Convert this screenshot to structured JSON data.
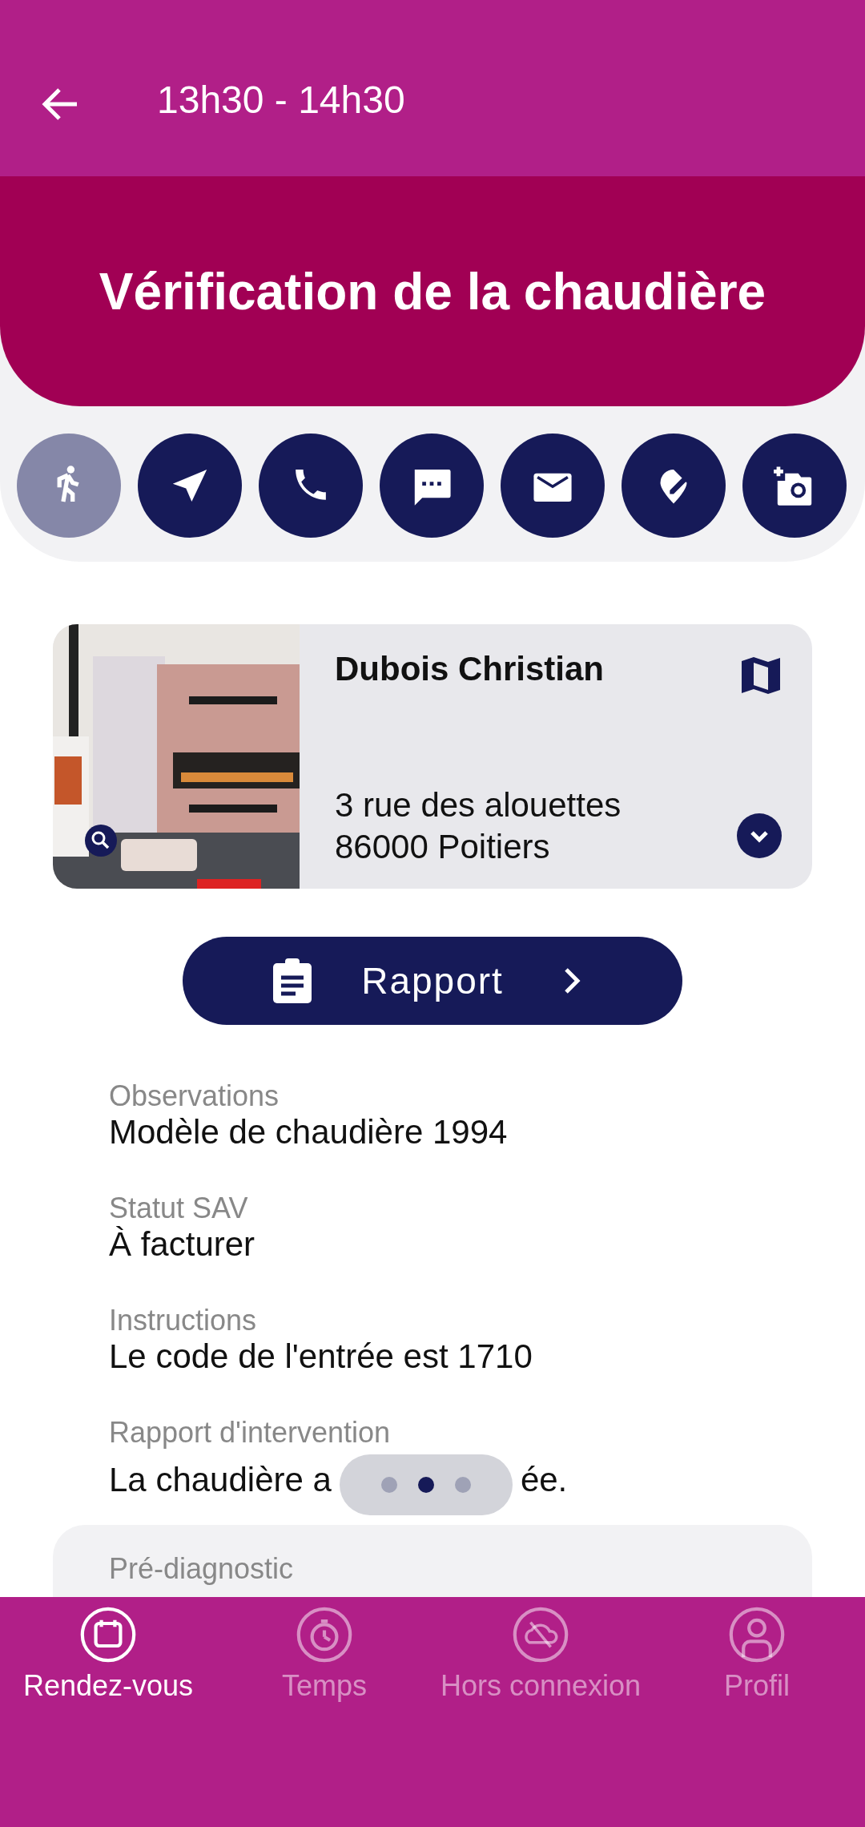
{
  "top_bar": {
    "title": "13h30 - 14h30"
  },
  "banner": {
    "title": "Vérification de la chaudière"
  },
  "actions": [
    {
      "kind": "walk",
      "disabled": true
    },
    {
      "kind": "navigate",
      "disabled": false
    },
    {
      "kind": "phone",
      "disabled": false
    },
    {
      "kind": "message",
      "disabled": false
    },
    {
      "kind": "mail",
      "disabled": false
    },
    {
      "kind": "pin-edit",
      "disabled": false
    },
    {
      "kind": "add-photo",
      "disabled": false
    }
  ],
  "client_card": {
    "name": "Dubois Christian",
    "address_lines": [
      "3 rue des alouettes",
      "86000 Poitiers"
    ]
  },
  "report_button": {
    "label": "Rapport"
  },
  "fields": [
    {
      "label": "Observations",
      "value_parts": [
        "Modèle de chaudière 1994"
      ]
    },
    {
      "label": "Statut SAV",
      "value_parts": [
        "À facturer"
      ]
    },
    {
      "label": "Instructions",
      "value_parts": [
        "Le code de l'entrée est 1710"
      ]
    },
    {
      "label": "Rapport d'intervention",
      "value_parts": [
        "La chaudière a",
        "ée."
      ]
    }
  ],
  "pager": [
    {
      "selected": false
    },
    {
      "selected": true
    },
    {
      "selected": false
    }
  ],
  "next_card": {
    "label": "Pré-diagnostic"
  },
  "bottom_nav": [
    {
      "kind": "calendar",
      "label": "Rendez-vous",
      "selected": true
    },
    {
      "kind": "timer",
      "label": "Temps",
      "selected": false
    },
    {
      "kind": "offline",
      "label": "Hors connexion",
      "selected": false
    },
    {
      "kind": "profile",
      "label": "Profil",
      "selected": false
    }
  ]
}
